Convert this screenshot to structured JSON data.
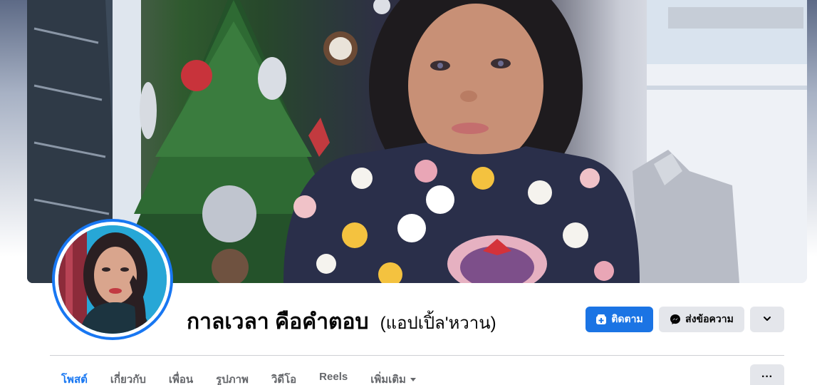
{
  "profile": {
    "name": "กาลเวลา คือคำตอบ",
    "alternate_name": "(แอปเปิ้ล'หวาน)"
  },
  "actions": {
    "follow_label": "ติดตาม",
    "message_label": "ส่งข้อความ",
    "more_icon": "chevron-down-icon"
  },
  "tabs": [
    {
      "label": "โพสต์",
      "active": true
    },
    {
      "label": "เกี่ยวกับ",
      "active": false
    },
    {
      "label": "เพื่อน",
      "active": false
    },
    {
      "label": "รูปภาพ",
      "active": false
    },
    {
      "label": "วิดีโอ",
      "active": false
    },
    {
      "label": "Reels",
      "active": false
    },
    {
      "label": "เพิ่มเติม",
      "active": false
    }
  ],
  "tab_overflow": {
    "label": "···"
  },
  "colors": {
    "accent": "#1877f2",
    "follow_button": "#1b74e4",
    "secondary_button": "#e4e6eb",
    "tab_inactive": "#65676b"
  }
}
